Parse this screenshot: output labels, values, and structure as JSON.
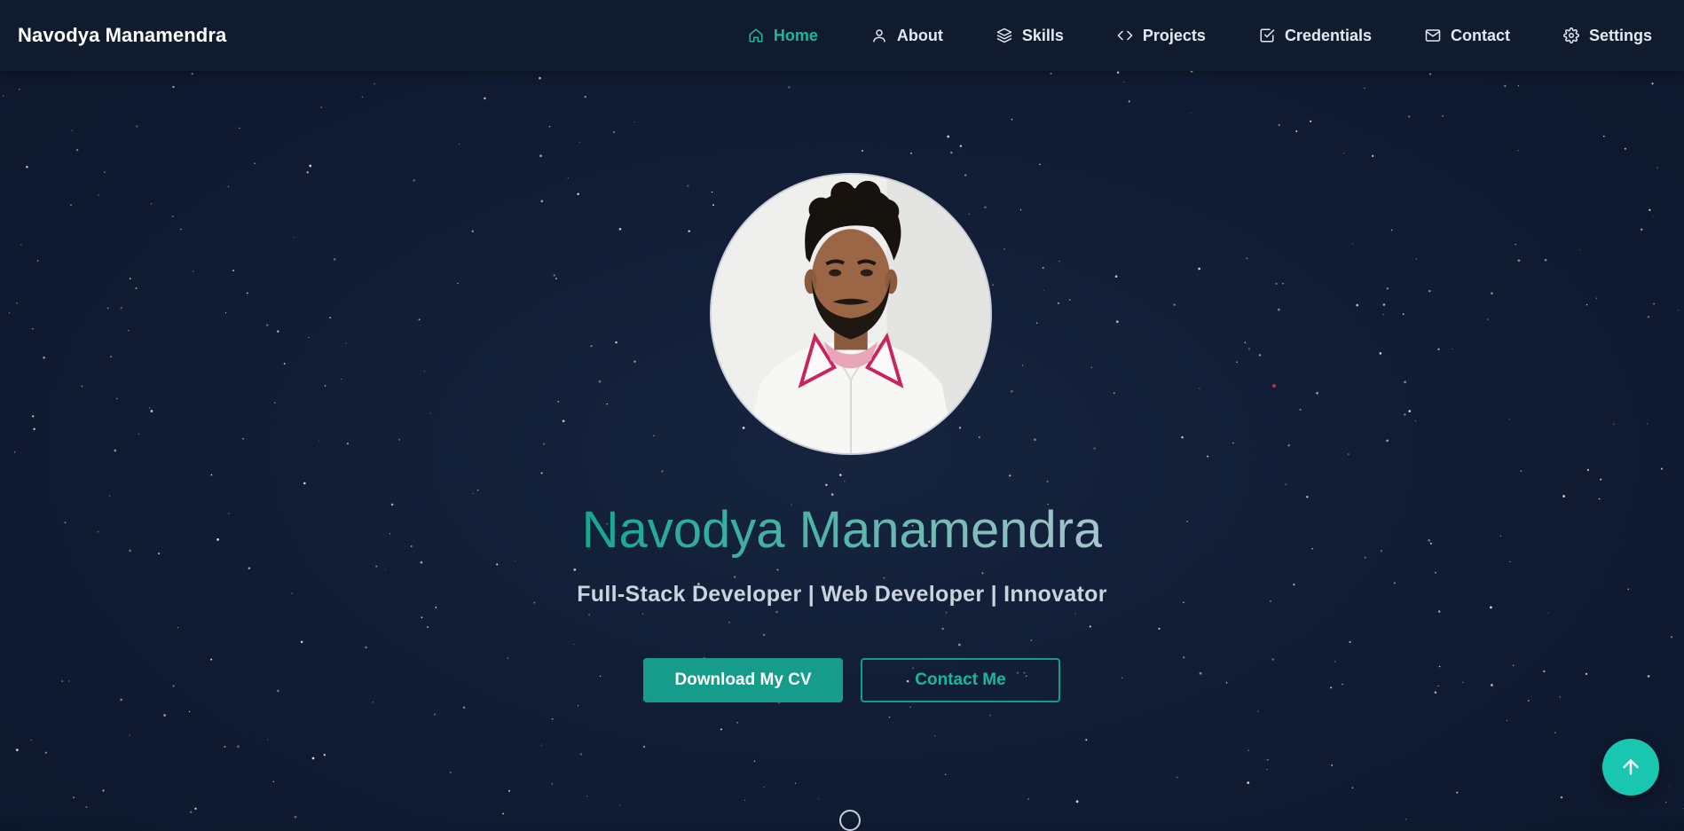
{
  "brand": {
    "name": "Navodya Manamendra"
  },
  "nav": {
    "items": [
      {
        "label": "Home",
        "icon": "home-icon",
        "active": true
      },
      {
        "label": "About",
        "icon": "user-icon",
        "active": false
      },
      {
        "label": "Skills",
        "icon": "layers-icon",
        "active": false
      },
      {
        "label": "Projects",
        "icon": "code-icon",
        "active": false
      },
      {
        "label": "Credentials",
        "icon": "check-square-icon",
        "active": false
      },
      {
        "label": "Contact",
        "icon": "mail-icon",
        "active": false
      },
      {
        "label": "Settings",
        "icon": "gear-icon",
        "active": false
      }
    ]
  },
  "hero": {
    "name": "Navodya Manamendra",
    "tagline": "Full-Stack Developer | Web Developer | Innovator",
    "download_cv_label": "Download My CV",
    "contact_label": "Contact Me"
  },
  "colors": {
    "accent": "#19b7a0",
    "button": "#169c8a",
    "background": "#111d35",
    "navbar": "#111b2e"
  }
}
